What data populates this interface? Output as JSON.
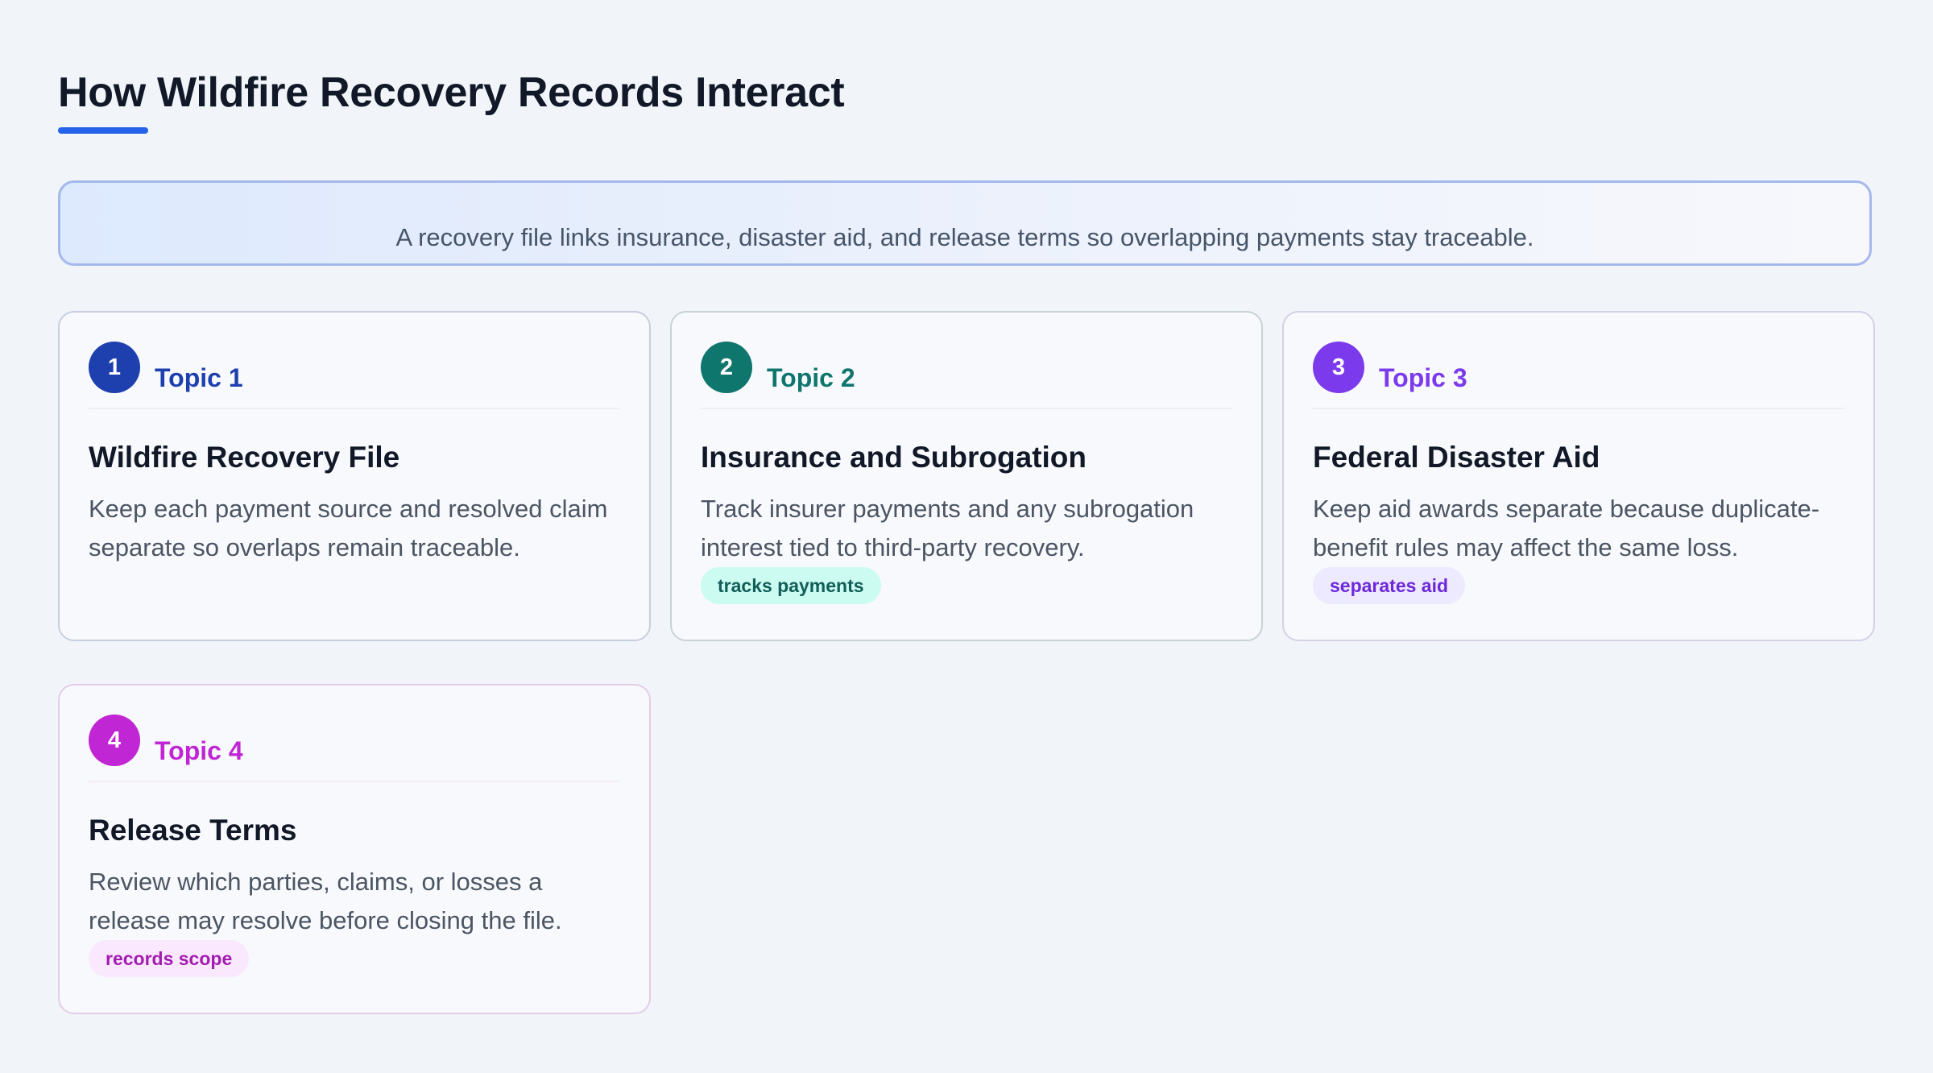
{
  "header": {
    "title": "How Wildfire Recovery Records Interact"
  },
  "summary": {
    "text": "A recovery file links insurance, disaster aid, and release terms so overlapping payments stay traceable."
  },
  "cards": [
    {
      "number": "1",
      "topic": "Topic 1",
      "title": "Wildfire Recovery File",
      "body": "Keep each payment source and resolved claim separate so overlaps remain traceable.",
      "tag": "",
      "color": "#1e40af"
    },
    {
      "number": "2",
      "topic": "Topic 2",
      "title": "Insurance and Subrogation",
      "body": "Track insurer payments and any subrogation interest tied to third-party recovery.",
      "tag": "tracks payments",
      "color": "#0f766e"
    },
    {
      "number": "3",
      "topic": "Topic 3",
      "title": "Federal Disaster Aid",
      "body": "Keep aid awards separate because duplicate-benefit rules may affect the same loss.",
      "tag": "separates aid",
      "color": "#7c3aed"
    },
    {
      "number": "4",
      "topic": "Topic 4",
      "title": "Release Terms",
      "body": "Review which parties, claims, or losses a release may resolve before closing the file.",
      "tag": "records scope",
      "color": "#c026d3"
    }
  ]
}
